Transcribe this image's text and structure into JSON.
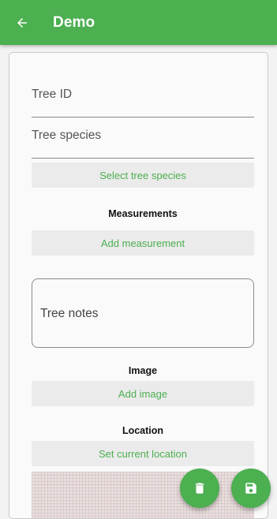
{
  "appbar": {
    "title": "Demo",
    "back_icon": "arrow-left-icon"
  },
  "form": {
    "tree_id_label": "Tree ID",
    "tree_species_label": "Tree species",
    "select_species_button": "Select tree species",
    "measurements_heading": "Measurements",
    "add_measurement_button": "Add measurement",
    "tree_notes_label": "Tree notes",
    "image_heading": "Image",
    "add_image_button": "Add image",
    "location_heading": "Location",
    "set_location_button": "Set current location"
  },
  "fabs": {
    "delete_icon": "trash-icon",
    "save_icon": "floppy-disk-icon"
  },
  "colors": {
    "primary": "#4caf50",
    "button_background": "#ebebeb",
    "page_background": "#f3f3f3"
  }
}
